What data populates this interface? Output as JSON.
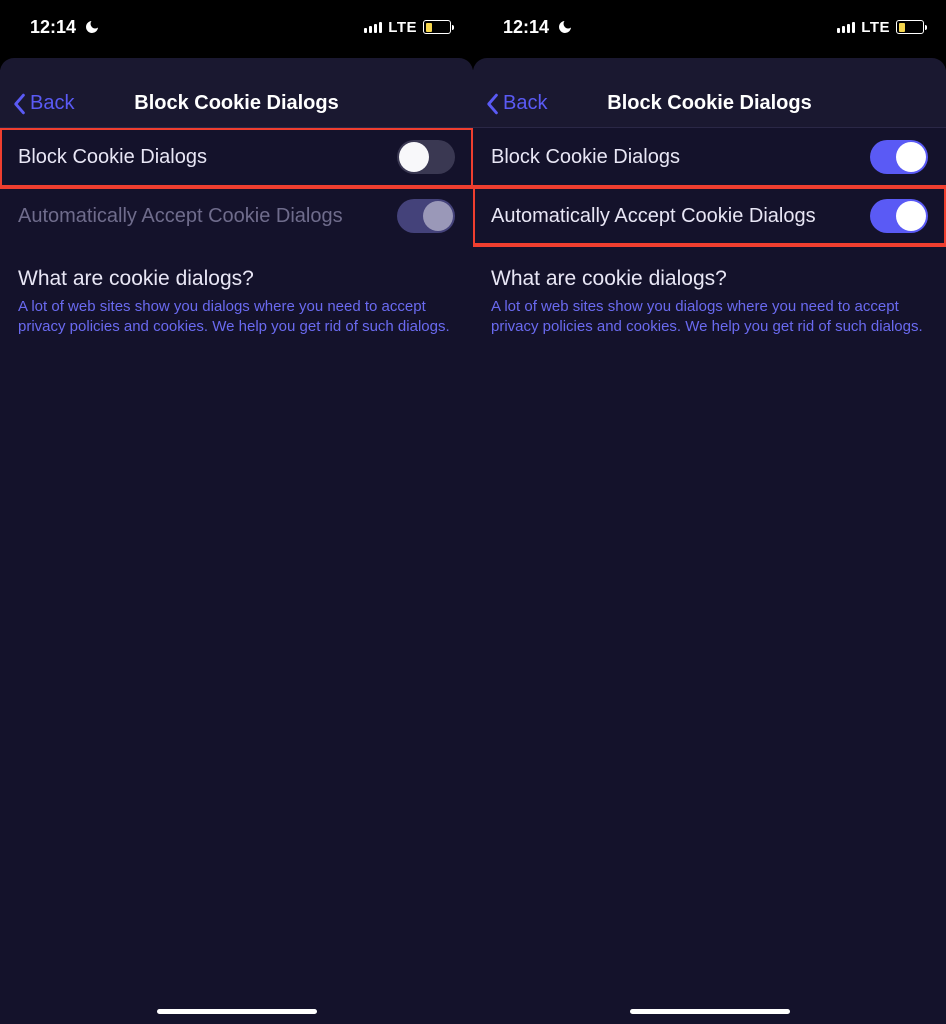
{
  "status": {
    "time": "12:14",
    "network_label": "LTE"
  },
  "nav": {
    "back_label": "Back",
    "title": "Block Cookie Dialogs"
  },
  "settings": {
    "row1_label": "Block Cookie Dialogs",
    "row2_label": "Automatically Accept Cookie Dialogs"
  },
  "info": {
    "heading": "What are cookie dialogs?",
    "body": "A lot of web sites show you dialogs where you need to accept privacy policies and cookies. We help you get rid of such dialogs."
  }
}
